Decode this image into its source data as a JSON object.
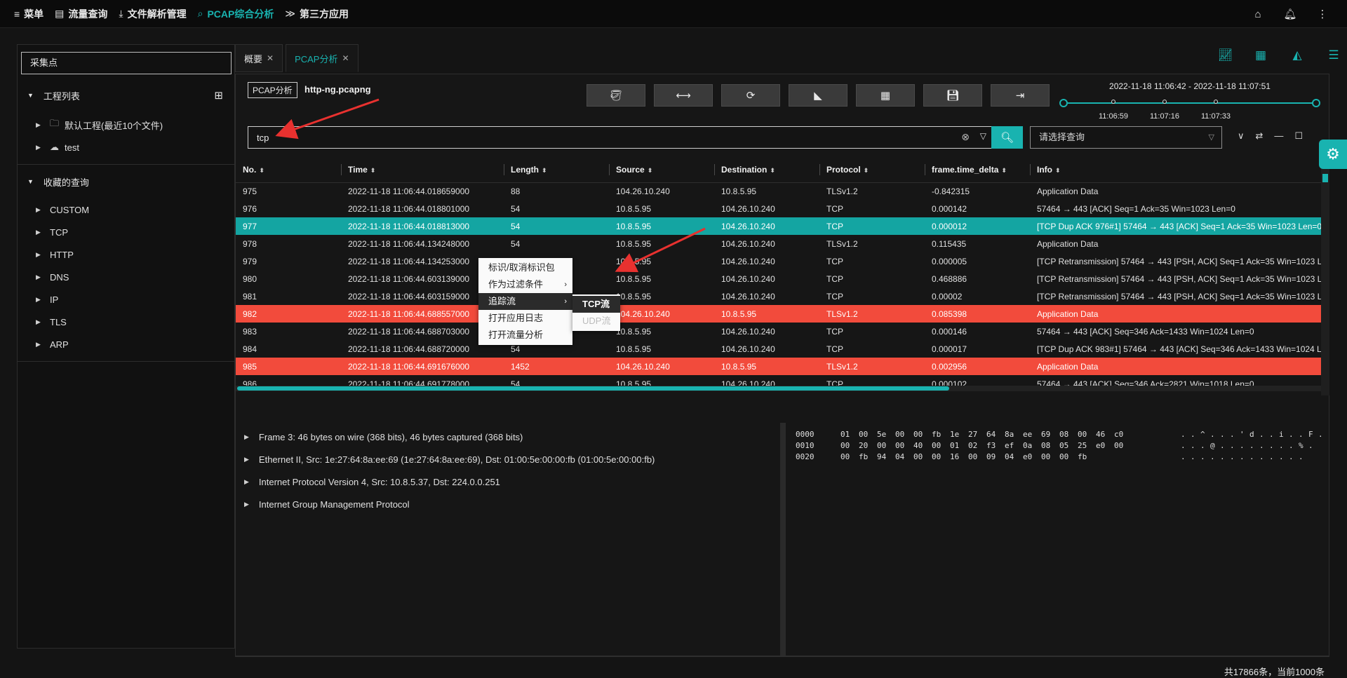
{
  "nav": {
    "items": [
      {
        "icon": "≡",
        "label": "菜单"
      },
      {
        "icon": "▤",
        "label": "流量查询"
      },
      {
        "icon": "⤓",
        "label": "文件解析管理"
      },
      {
        "icon": "⌕",
        "label": "PCAP综合分析"
      },
      {
        "icon": "≫",
        "label": "第三方应用"
      }
    ],
    "active_index": 3,
    "right_icons": [
      "home-icon",
      "bell-icon",
      "more-icon"
    ]
  },
  "sidebar": {
    "collect_placeholder": "采集点",
    "project_title": "工程列表",
    "projects": [
      {
        "label": "默认工程(最近10个文件)",
        "icon": "folder-icon"
      },
      {
        "label": "test",
        "icon": "cloud-icon"
      }
    ],
    "fav_title": "收藏的查询",
    "favorites": [
      "CUSTOM",
      "TCP",
      "HTTP",
      "DNS",
      "IP",
      "TLS",
      "ARP"
    ]
  },
  "tabs": [
    {
      "label": "概要"
    },
    {
      "label": "PCAP分析"
    }
  ],
  "analysis": {
    "badge": "PCAP分析",
    "filename": "http-ng.pcapng",
    "time_range": "2022-11-18 11:06:42 - 2022-11-18 11:07:51",
    "time_ticks": [
      "11:06:59",
      "11:07:16",
      "11:07:33"
    ],
    "filter_value": "tcp",
    "query_placeholder": "请选择查询"
  },
  "table": {
    "columns": [
      "No.",
      "Time",
      "Length",
      "Source",
      "Destination",
      "Protocol",
      "frame.time_delta",
      "Info"
    ],
    "rows": [
      [
        "975",
        "2022-11-18 11:06:44.018659000",
        "88",
        "104.26.10.240",
        "10.8.5.95",
        "TLSv1.2",
        "-0.842315",
        "Application Data"
      ],
      [
        "976",
        "2022-11-18 11:06:44.018801000",
        "54",
        "10.8.5.95",
        "104.26.10.240",
        "TCP",
        "0.000142",
        "57464 → 443 [ACK] Seq=1 Ack=35 Win=1023 Len=0"
      ],
      [
        "977",
        "2022-11-18 11:06:44.018813000",
        "54",
        "10.8.5.95",
        "104.26.10.240",
        "TCP",
        "0.000012",
        "[TCP Dup ACK 976#1] 57464 → 443 [ACK] Seq=1 Ack=35 Win=1023 Len=0"
      ],
      [
        "978",
        "2022-11-18 11:06:44.134248000",
        "54",
        "10.8.5.95",
        "104.26.10.240",
        "TLSv1.2",
        "0.115435",
        "Application Data"
      ],
      [
        "979",
        "2022-11-18 11:06:44.134253000",
        "54",
        "10.8.5.95",
        "104.26.10.240",
        "TCP",
        "0.000005",
        "[TCP Retransmission] 57464 → 443 [PSH, ACK] Seq=1 Ack=35 Win=1023 Len="
      ],
      [
        "980",
        "2022-11-18 11:06:44.603139000",
        "54",
        "10.8.5.95",
        "104.26.10.240",
        "TCP",
        "0.468886",
        "[TCP Retransmission] 57464 → 443 [PSH, ACK] Seq=1 Ack=35 Win=1023 Len="
      ],
      [
        "981",
        "2022-11-18 11:06:44.603159000",
        "54",
        "10.8.5.95",
        "104.26.10.240",
        "TCP",
        "0.00002",
        "[TCP Retransmission] 57464 → 443 [PSH, ACK] Seq=1 Ack=35 Win=1023 Len="
      ],
      [
        "982",
        "2022-11-18 11:06:44.688557000",
        "1452",
        "104.26.10.240",
        "10.8.5.95",
        "TLSv1.2",
        "0.085398",
        "Application Data"
      ],
      [
        "983",
        "2022-11-18 11:06:44.688703000",
        "54",
        "10.8.5.95",
        "104.26.10.240",
        "TCP",
        "0.000146",
        "57464 → 443 [ACK] Seq=346 Ack=1433 Win=1024 Len=0"
      ],
      [
        "984",
        "2022-11-18 11:06:44.688720000",
        "54",
        "10.8.5.95",
        "104.26.10.240",
        "TCP",
        "0.000017",
        "[TCP Dup ACK 983#1] 57464 → 443 [ACK] Seq=346 Ack=1433 Win=1024 Len"
      ],
      [
        "985",
        "2022-11-18 11:06:44.691676000",
        "1452",
        "104.26.10.240",
        "10.8.5.95",
        "TLSv1.2",
        "0.002956",
        "Application Data"
      ],
      [
        "986",
        "2022-11-18 11:06:44.691778000",
        "54",
        "10.8.5.95",
        "104.26.10.240",
        "TCP",
        "0.000102",
        "57464 → 443 [ACK] Seq=346 Ack=2821 Win=1018 Len=0"
      ]
    ],
    "selected_no": "977",
    "highlight_nos": [
      "982",
      "985"
    ]
  },
  "context_menu": {
    "items": [
      "标识/取消标识包",
      "作为过滤条件",
      "追踪流",
      "打开应用日志",
      "打开流量分析"
    ],
    "submenu": [
      "TCP流",
      "UDP流"
    ]
  },
  "detail": {
    "rows": [
      "Frame 3: 46 bytes on wire (368 bits), 46 bytes captured (368 bits)",
      "Ethernet II, Src: 1e:27:64:8a:ee:69 (1e:27:64:8a:ee:69), Dst: 01:00:5e:00:00:fb (01:00:5e:00:00:fb)",
      "Internet Protocol Version 4, Src: 10.8.5.37, Dst: 224.0.0.251",
      "Internet Group Management Protocol"
    ]
  },
  "hex": {
    "rows": [
      {
        "offset": "0000",
        "bytes": [
          "01",
          "00",
          "5e",
          "00",
          "00",
          "fb",
          "1e",
          "27",
          "64",
          "8a",
          "ee",
          "69",
          "08",
          "00",
          "46",
          "c0"
        ],
        "ascii": [
          ".",
          ".",
          "^",
          ".",
          ".",
          ".",
          "'",
          "d",
          ".",
          ".",
          "i",
          ".",
          ".",
          "F",
          "."
        ]
      },
      {
        "offset": "0010",
        "bytes": [
          "00",
          "20",
          "00",
          "00",
          "40",
          "00",
          "01",
          "02",
          "f3",
          "ef",
          "0a",
          "08",
          "05",
          "25",
          "e0",
          "00"
        ],
        "ascii": [
          ".",
          ".",
          ".",
          "@",
          ".",
          ".",
          ".",
          ".",
          ".",
          ".",
          ".",
          ".",
          "%",
          "."
        ]
      },
      {
        "offset": "0020",
        "bytes": [
          "00",
          "fb",
          "94",
          "04",
          "00",
          "00",
          "16",
          "00",
          "09",
          "04",
          "e0",
          "00",
          "00",
          "fb"
        ],
        "ascii": [
          ".",
          ".",
          ".",
          ".",
          ".",
          ".",
          ".",
          ".",
          ".",
          ".",
          ".",
          ".",
          "."
        ]
      }
    ]
  },
  "status": "共17866条，当前1000条",
  "colors": {
    "accent": "#19b3b0",
    "highlight_red": "#f24b3c",
    "annotation": "#e8312f"
  }
}
